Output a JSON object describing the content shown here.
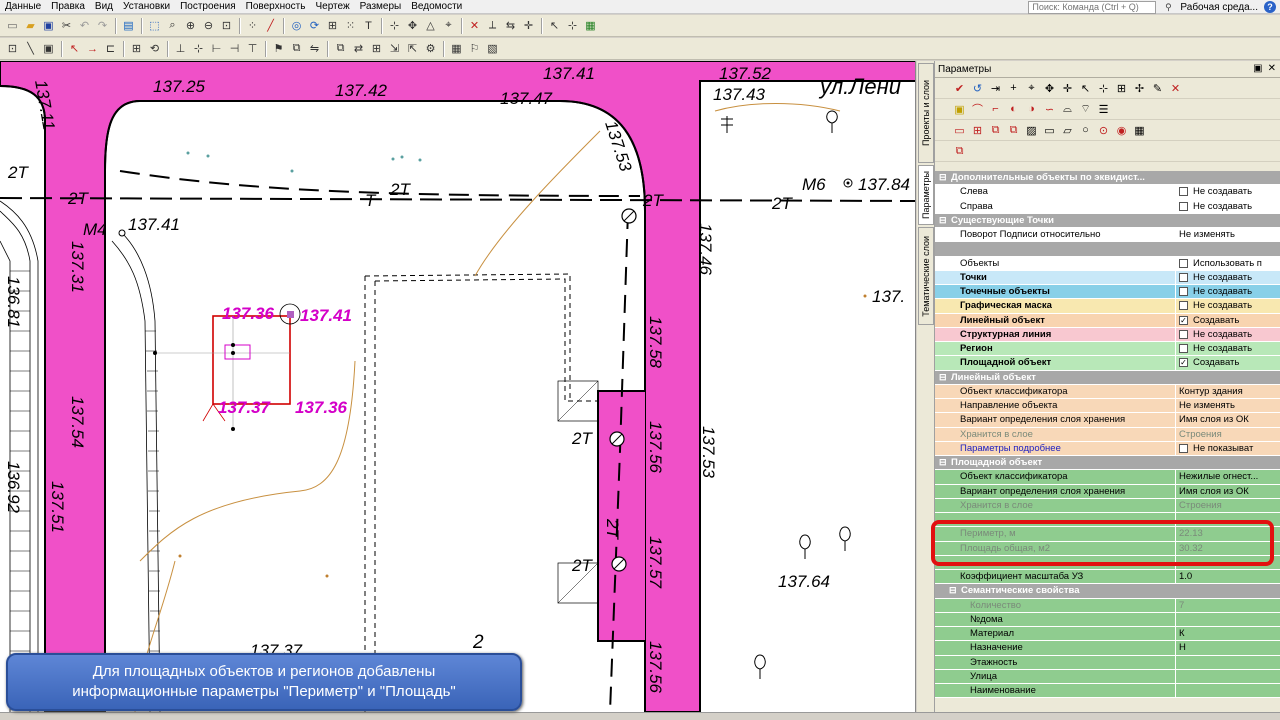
{
  "menu": {
    "items": [
      "Данные",
      "Правка",
      "Вид",
      "Установки",
      "Построения",
      "Поверхность",
      "Чертеж",
      "Размеры",
      "Ведомости"
    ],
    "search_placeholder": "Поиск: Команда (Ctrl + Q)",
    "workspace_label": "Рабочая среда..."
  },
  "map": {
    "labels": [
      "137.25",
      "137.42",
      "137.47",
      "137.41",
      "137.52",
      "137.43",
      "ул.Лени",
      "137.11",
      "2Т",
      "2Т",
      "2Т",
      "Т",
      "2Т",
      "М6",
      "137.84",
      "2Т",
      "137.53",
      "137.41",
      "М4",
      "137.31",
      "136.81",
      "137.36",
      "137.41",
      "137.37",
      "137.36",
      "137.46",
      "137.58",
      "137.54",
      "137.56",
      "2Т",
      "137.53",
      "136.92",
      "137.51",
      "2Т",
      "2Т",
      "137.57",
      "137.64",
      "137.37",
      "2",
      "137.56",
      "137."
    ],
    "colors": {
      "road": "#f050c8",
      "highlight": "#d400c8"
    }
  },
  "tabs": {
    "vertical": [
      "Проекты и слои",
      "Параметры",
      "Тематические слои"
    ],
    "active": "Параметры"
  },
  "panel": {
    "title": "Параметры",
    "rows": [
      {
        "type": "group",
        "name": "Дополнительные объекты по эквидист..."
      },
      {
        "type": "white",
        "name": "Слева",
        "value": "Не создавать",
        "check": ""
      },
      {
        "type": "white",
        "name": "Справа",
        "value": "Не создавать",
        "check": ""
      },
      {
        "type": "group",
        "name": "Существующие Точки"
      },
      {
        "type": "white",
        "name": "Поворот Подписи относительно",
        "value": "Не изменять"
      },
      {
        "type": "blank"
      },
      {
        "type": "white",
        "name": "Объекты",
        "value": "Использовать п",
        "check": ""
      },
      {
        "type": "color",
        "color": "#c8e8f8",
        "name": "Точки",
        "value": "Не создавать",
        "check": "",
        "bold": true
      },
      {
        "type": "color",
        "color": "#88d0e8",
        "name": "Точечные объекты",
        "value": "Не создавать",
        "check": "",
        "bold": true
      },
      {
        "type": "color",
        "color": "#f8e8b0",
        "name": "Графическая маска",
        "value": "Не создавать",
        "check": "",
        "bold": true
      },
      {
        "type": "color",
        "color": "#f8d4b0",
        "name": "Линейный объект",
        "value": "Создавать",
        "check": "✓",
        "bold": true
      },
      {
        "type": "color",
        "color": "#f8c8d0",
        "name": "Структурная линия",
        "value": "Не создавать",
        "check": "",
        "bold": true
      },
      {
        "type": "color",
        "color": "#b8e8b8",
        "name": "Регион",
        "value": "Не создавать",
        "check": "",
        "bold": true
      },
      {
        "type": "color",
        "color": "#b8e8b8",
        "name": "Площадной объект",
        "value": "Создавать",
        "check": "✓",
        "bold": true
      },
      {
        "type": "group",
        "name": "Линейный объект"
      },
      {
        "type": "color",
        "color": "#f8d8b8",
        "name": "Объект классификатора",
        "value": "Контур здания"
      },
      {
        "type": "color",
        "color": "#f8d8b8",
        "name": "Направление объекта",
        "value": "Не изменять"
      },
      {
        "type": "color",
        "color": "#f8d8b8",
        "name": "Вариант определения слоя хранения",
        "value": "Имя слоя из ОК"
      },
      {
        "type": "color",
        "color": "#f8d8b8",
        "name": "Хранится в слое",
        "value": "Строения",
        "grey": true
      },
      {
        "type": "color",
        "color": "#f8d8b8",
        "name": "Параметры подробнее",
        "value": "Не показыват",
        "check": "",
        "link": true
      },
      {
        "type": "group",
        "name": "Площадной объект"
      },
      {
        "type": "green",
        "name": "Объект классификатора",
        "value": "Нежилые огнест..."
      },
      {
        "type": "green",
        "name": "Вариант определения слоя хранения",
        "value": "Имя слоя из ОК"
      },
      {
        "type": "green",
        "name": "Хранится в слое",
        "value": "Строения",
        "grey": true
      },
      {
        "type": "green",
        "name": "",
        "value": ""
      },
      {
        "type": "green",
        "name": "Периметр, м",
        "value": "22.13",
        "grey": true
      },
      {
        "type": "green",
        "name": "Площадь общая, м2",
        "value": "30.32",
        "grey": true
      },
      {
        "type": "green",
        "name": "",
        "value": ""
      },
      {
        "type": "green",
        "name": "Коэффициент масштаба УЗ",
        "value": "1.0"
      },
      {
        "type": "group",
        "name": "Семантические свойства",
        "indent": true
      },
      {
        "type": "green",
        "name": "Количество",
        "value": "7",
        "grey": true,
        "sub": true
      },
      {
        "type": "green",
        "name": "№дома",
        "value": "",
        "sub": true
      },
      {
        "type": "green",
        "name": "Материал",
        "value": "К",
        "sub": true
      },
      {
        "type": "green",
        "name": "Назначение",
        "value": "Н",
        "sub": true
      },
      {
        "type": "green",
        "name": "Этажность",
        "value": "",
        "sub": true
      },
      {
        "type": "green",
        "name": "Улица",
        "value": "",
        "sub": true
      },
      {
        "type": "green",
        "name": "Наименование",
        "value": "",
        "sub": true
      }
    ]
  },
  "caption": {
    "line1": "Для площадных объектов и регионов добавлены",
    "line2": "информационные параметры \"Периметр\" и \"Площадь\""
  }
}
